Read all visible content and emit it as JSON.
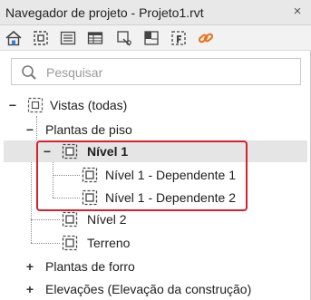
{
  "window": {
    "title": "Navegador de projeto - Projeto1.rvt",
    "close_glyph": "×"
  },
  "toolbar": {
    "buttons": [
      {
        "icon": "home-icon"
      },
      {
        "icon": "view-icon"
      },
      {
        "icon": "properties-icon"
      },
      {
        "icon": "schedule-icon"
      },
      {
        "icon": "tag-icon"
      },
      {
        "icon": "sheet-icon"
      },
      {
        "icon": "family-icon"
      },
      {
        "icon": "link-icon"
      }
    ]
  },
  "search": {
    "placeholder": "Pesquisar"
  },
  "tree": {
    "vistas": {
      "label": "Vistas (todas)",
      "toggle": "−"
    },
    "plantas_piso": {
      "label": "Plantas de piso",
      "toggle": "−"
    },
    "nivel1": {
      "label": "Nível 1",
      "toggle": "−",
      "selected": true
    },
    "dep1": {
      "label": "Nível 1 - Dependente 1"
    },
    "dep2": {
      "label": "Nível 1 - Dependente 2"
    },
    "nivel2": {
      "label": "Nível 2"
    },
    "terreno": {
      "label": "Terreno"
    },
    "plantas_forro": {
      "label": "Plantas de forro",
      "toggle": "+"
    },
    "elevacoes": {
      "label": "Elevações (Elevação da construção)",
      "toggle": "+"
    }
  },
  "colors": {
    "selection_outline": "#d6202b",
    "link_icon": "#e87722",
    "highlight_row": "#e5e5e5"
  }
}
